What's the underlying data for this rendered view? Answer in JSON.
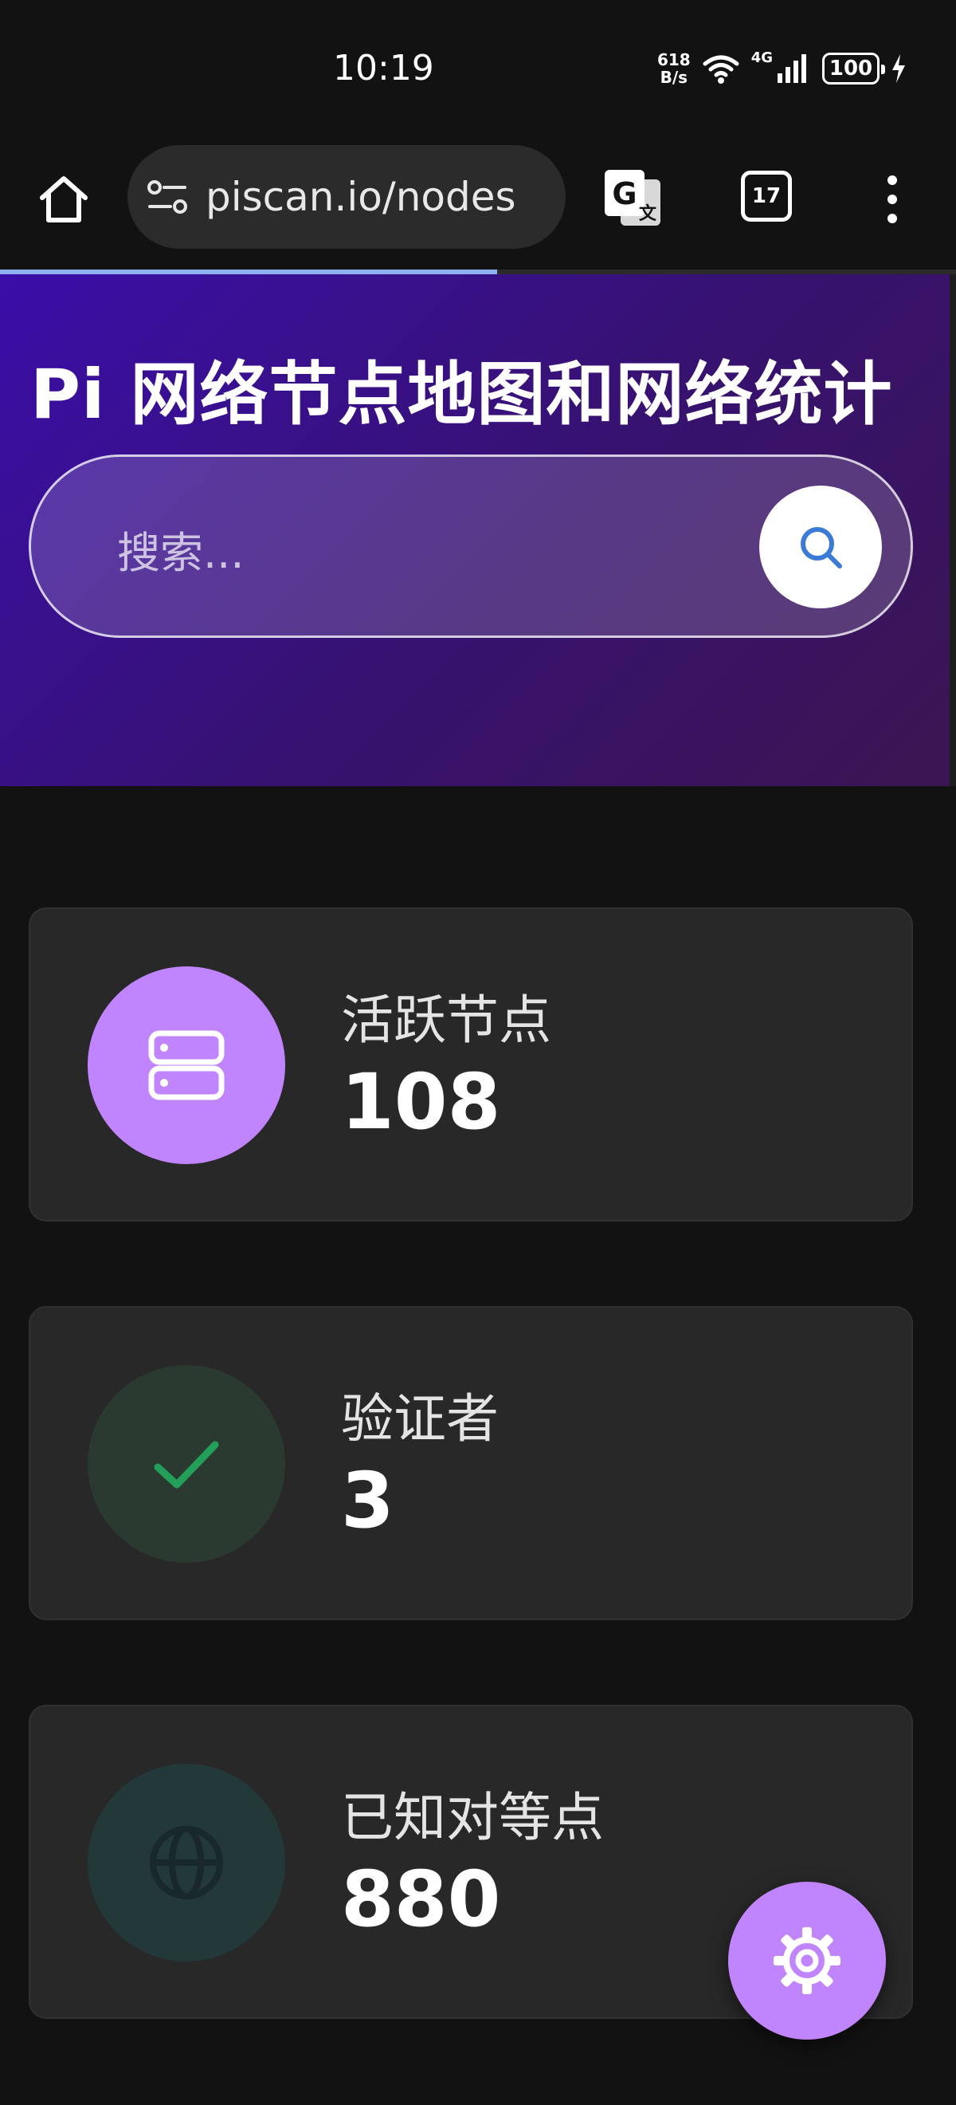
{
  "status_bar": {
    "time": "10:19",
    "net_speed_value": "618",
    "net_speed_unit": "B/s",
    "network_type": "4G",
    "battery": "100"
  },
  "browser": {
    "url": "piscan.io/nodes",
    "tab_count": "17",
    "load_progress_percent": 52
  },
  "hero": {
    "title": "Pi 网络节点地图和网络统计",
    "search_placeholder": "搜索..."
  },
  "stats": [
    {
      "label": "活跃节点",
      "value": "108",
      "icon": "server-icon",
      "icon_bg": "#c084fc",
      "icon_color": "#ffffff"
    },
    {
      "label": "验证者",
      "value": "3",
      "icon": "check-icon",
      "icon_bg": "#2a3a30",
      "icon_color": "#22a05a"
    },
    {
      "label": "已知对等点",
      "value": "880",
      "icon": "globe-icon",
      "icon_bg": "#233838",
      "icon_color": "#1a2a2d"
    }
  ],
  "colors": {
    "accent": "#c084fc",
    "background": "#121212",
    "card": "#282828",
    "search_icon": "#3b7bd6"
  }
}
